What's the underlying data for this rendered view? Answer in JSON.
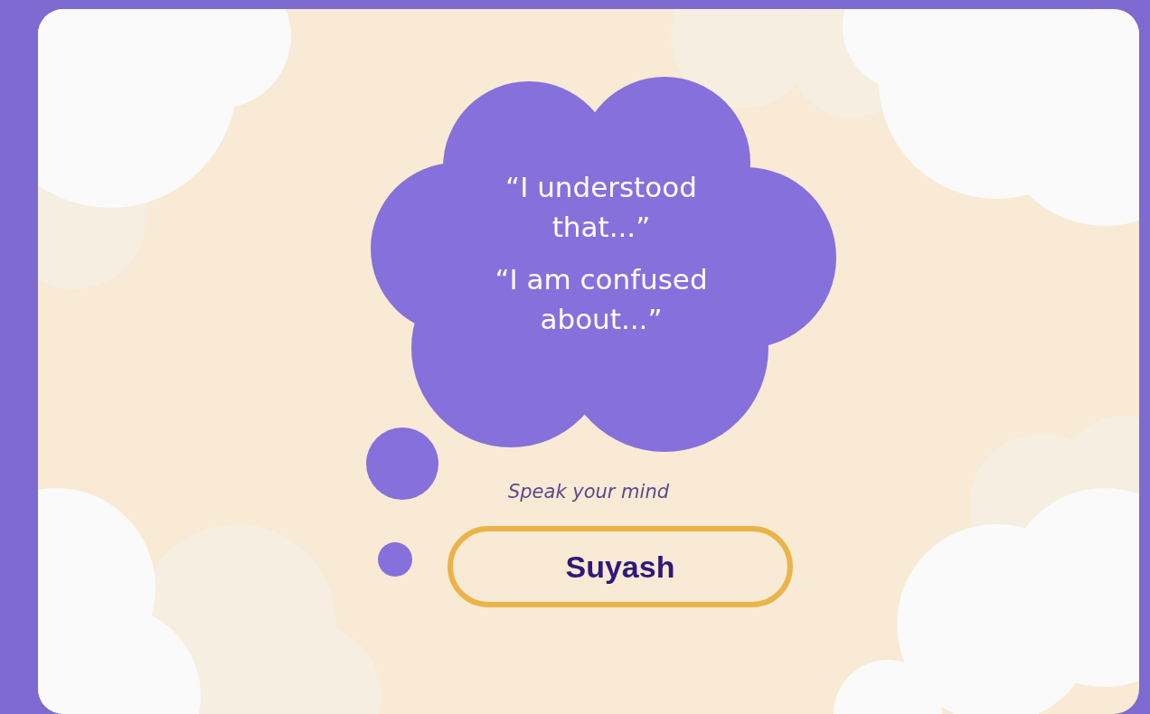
{
  "thought_cloud": {
    "quotes": [
      "“I understood that...”",
      "“I am confused about...”"
    ]
  },
  "prompt": "Speak your mind",
  "name_button": {
    "label": "Suyash"
  }
}
